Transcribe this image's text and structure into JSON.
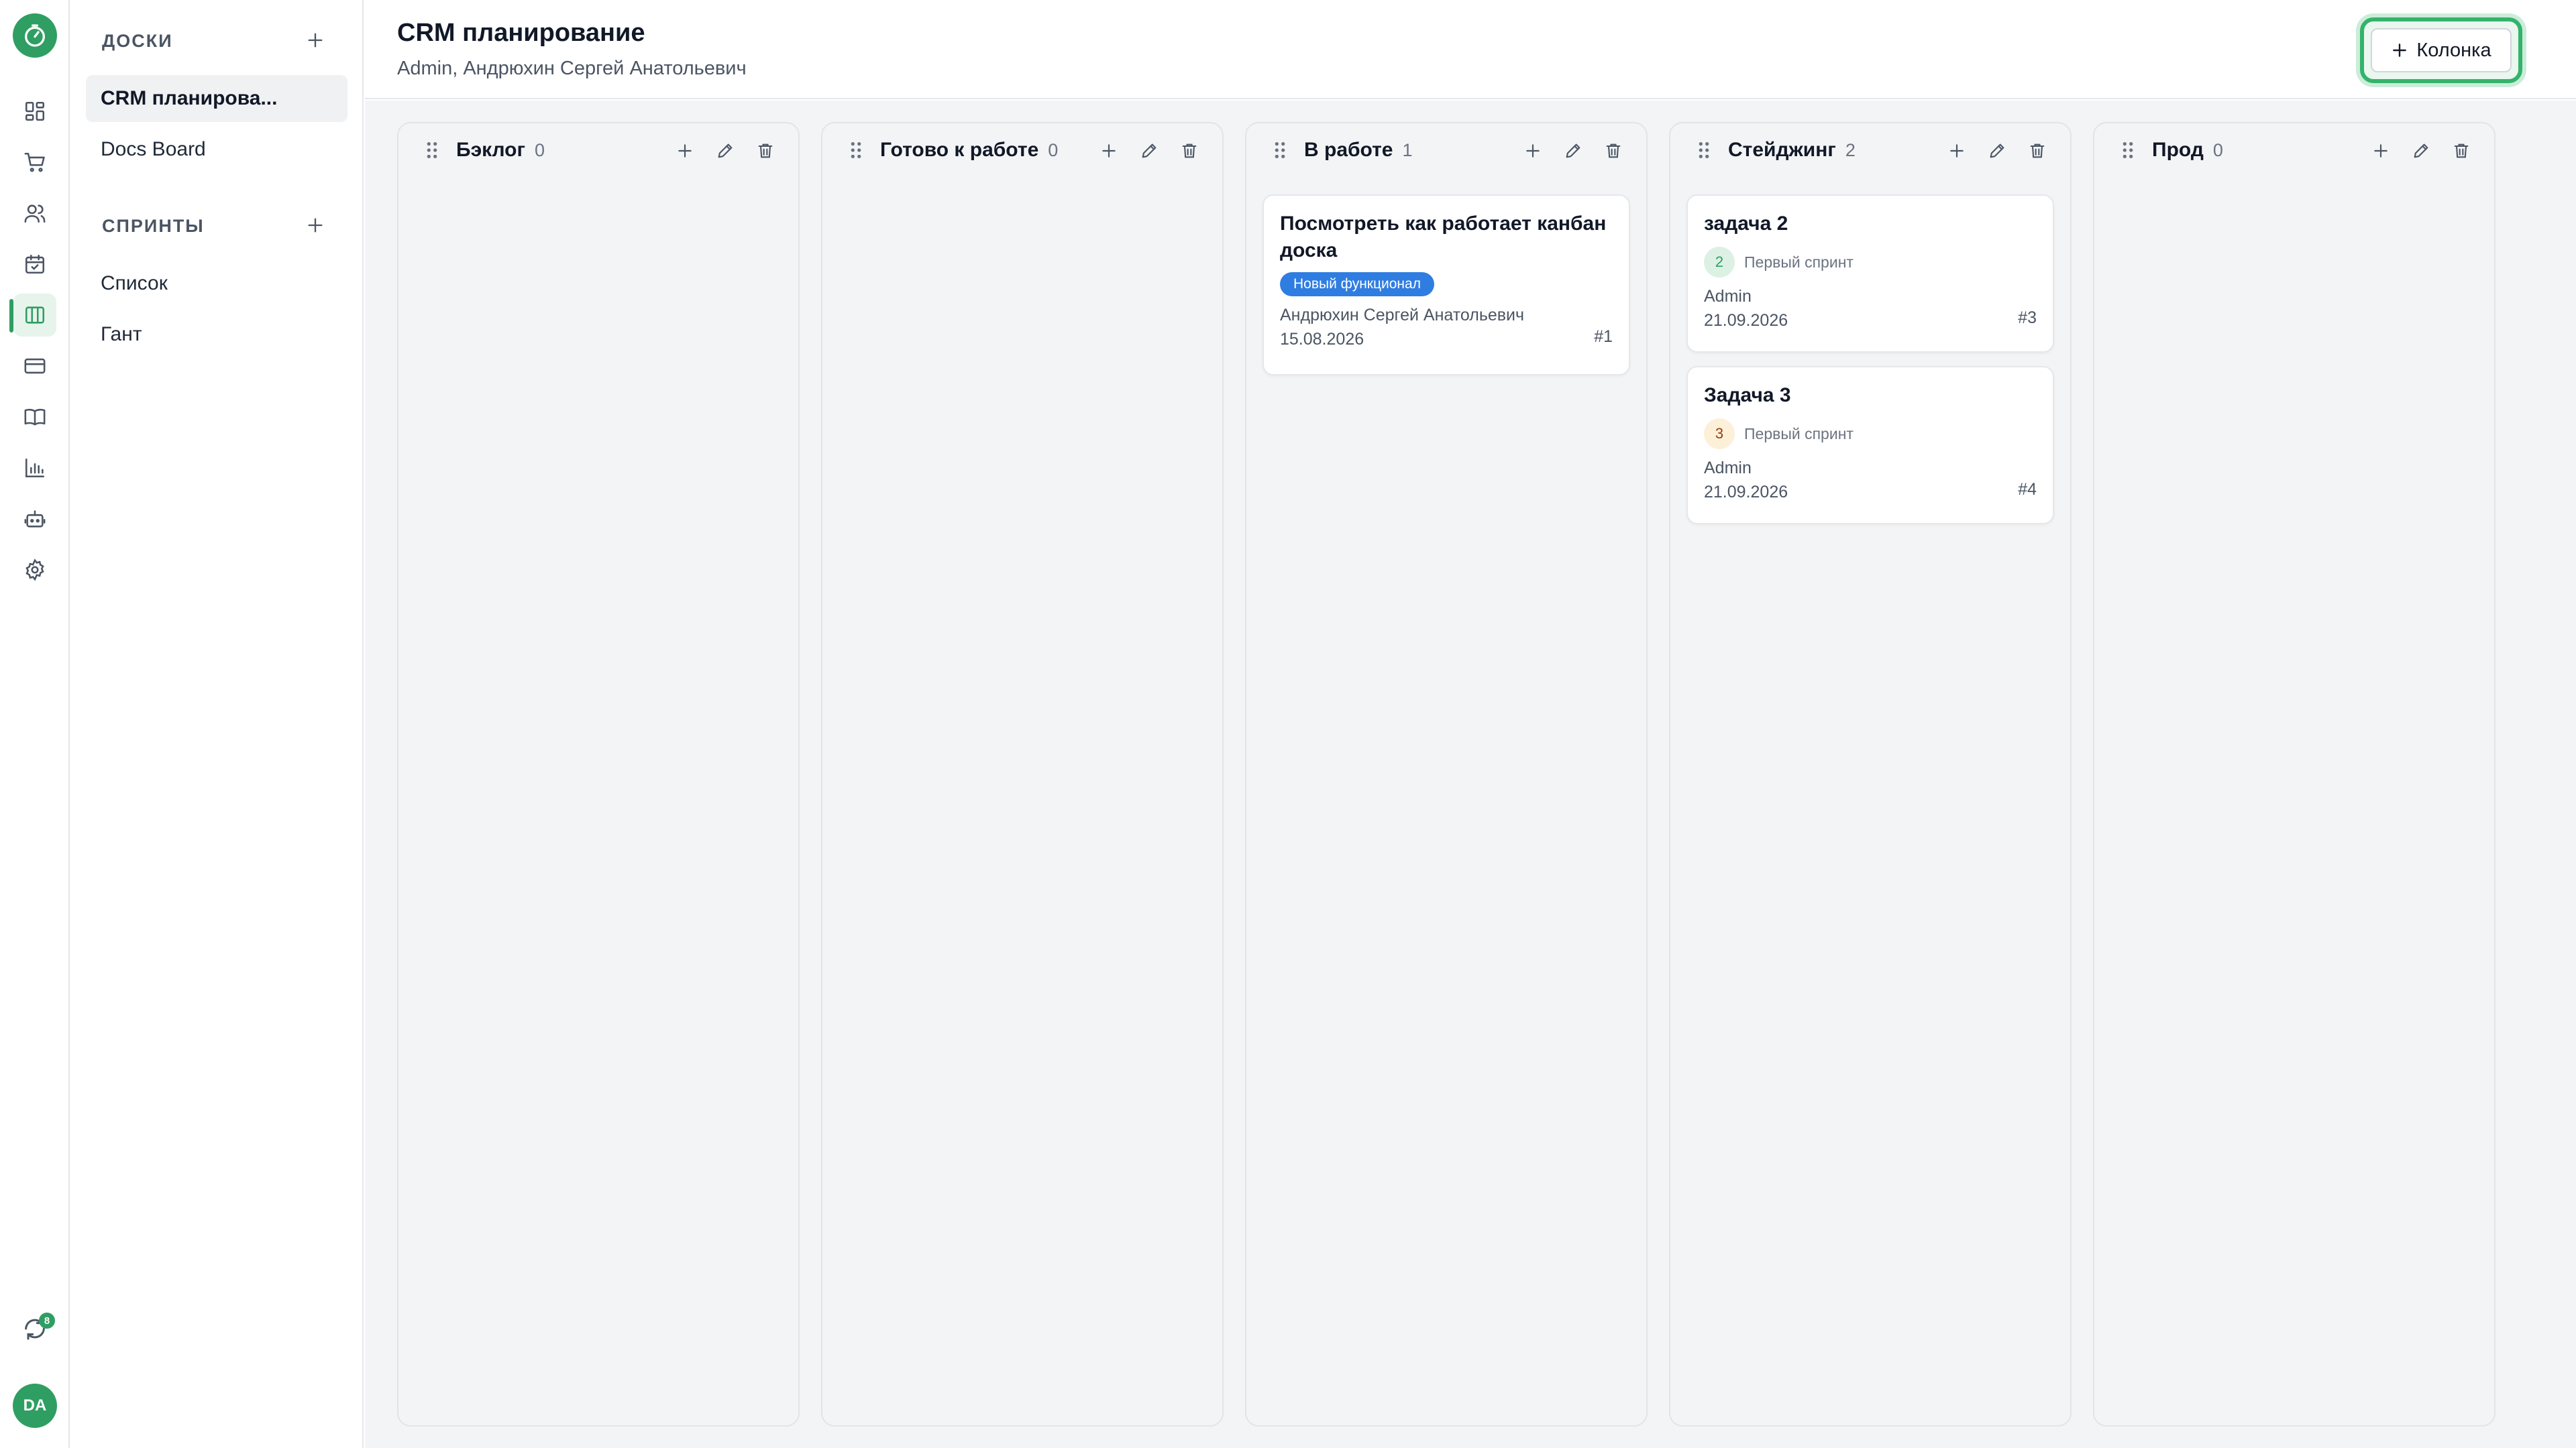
{
  "rail": {
    "items": [
      {
        "icon": "dashboard-icon"
      },
      {
        "icon": "cart-icon"
      },
      {
        "icon": "users-icon"
      },
      {
        "icon": "calendar-check-icon"
      },
      {
        "icon": "kanban-board-icon"
      },
      {
        "icon": "credit-card-icon"
      },
      {
        "icon": "book-icon"
      },
      {
        "icon": "bar-chart-icon"
      },
      {
        "icon": "bot-icon"
      },
      {
        "icon": "settings-icon"
      }
    ],
    "sync_badge": "8",
    "avatar_initials": "DA"
  },
  "sidebar": {
    "boards_heading": "ДОСКИ",
    "boards": [
      {
        "label": "CRM планирова..."
      },
      {
        "label": "Docs Board"
      }
    ],
    "sprints_heading": "СПРИНТЫ",
    "sprint_views": [
      {
        "label": "Список"
      },
      {
        "label": "Гант"
      }
    ]
  },
  "header": {
    "title": "CRM планирование",
    "subtitle": "Admin, Андрюхин Сергей Анатольевич",
    "add_column_label": "Колонка"
  },
  "colors": {
    "brand": "#2f9e62",
    "tag": "#2f7de1"
  },
  "columns": [
    {
      "title": "Бэклог",
      "count": "0",
      "cards": []
    },
    {
      "title": "Готово к работе",
      "count": "0",
      "cards": []
    },
    {
      "title": "В работе",
      "count": "1",
      "cards": [
        {
          "title": "Посмотреть как работает канбан доска",
          "tag": "Новый функционал",
          "assignee": "Андрюхин Сергей Анатольевич",
          "date": "15.08.2026",
          "id": "#1"
        }
      ]
    },
    {
      "title": "Стейджинг",
      "count": "2",
      "cards": [
        {
          "title": "задача 2",
          "sprint_number": "2",
          "sprint_name": "Первый спринт",
          "assignee": "Admin",
          "date": "21.09.2026",
          "id": "#3"
        },
        {
          "title": "Задача 3",
          "sprint_number": "3",
          "sprint_name": "Первый спринт",
          "assignee": "Admin",
          "date": "21.09.2026",
          "id": "#4"
        }
      ]
    },
    {
      "title": "Прод",
      "count": "0",
      "cards": []
    }
  ]
}
